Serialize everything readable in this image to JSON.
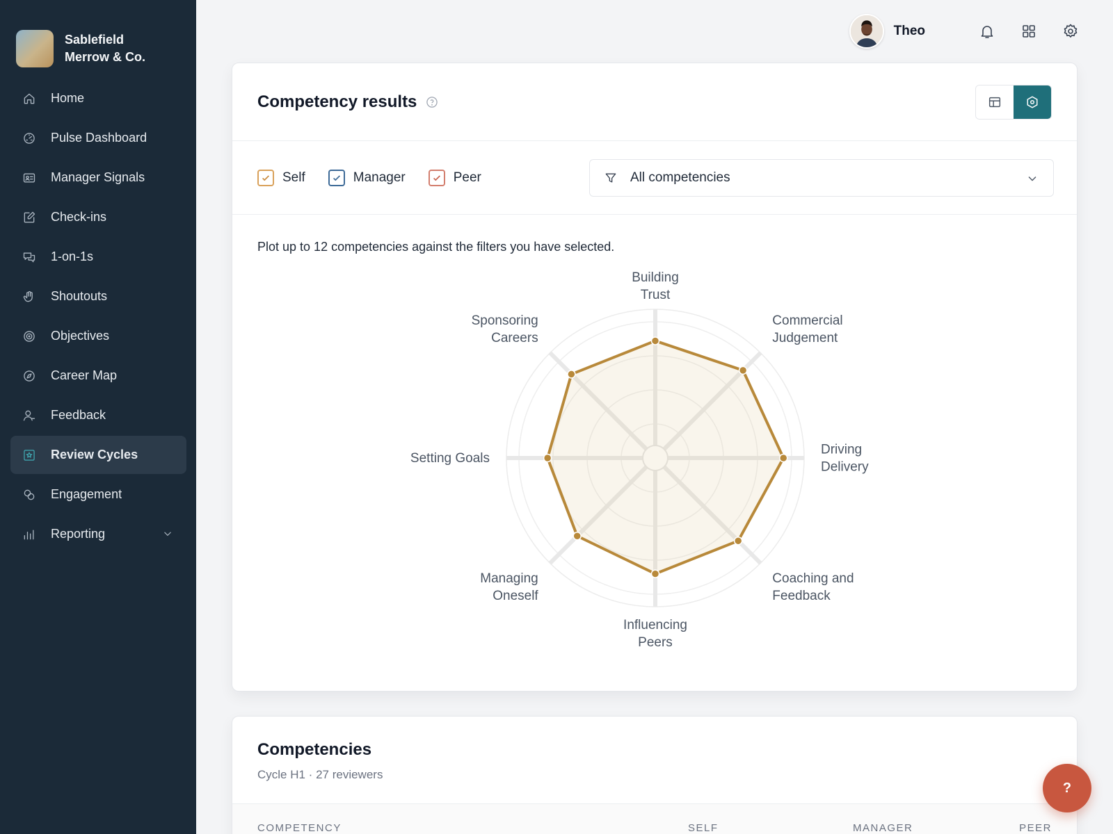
{
  "brand": {
    "name_line1": "Sablefield",
    "name_line2": "Merrow & Co."
  },
  "sidebar": {
    "items": [
      {
        "label": "Home",
        "icon": "home-icon"
      },
      {
        "label": "Pulse Dashboard",
        "icon": "gauge-icon"
      },
      {
        "label": "Manager Signals",
        "icon": "id-card-icon"
      },
      {
        "label": "Check-ins",
        "icon": "edit-icon"
      },
      {
        "label": "1-on-1s",
        "icon": "chat-icon"
      },
      {
        "label": "Shoutouts",
        "icon": "hand-icon"
      },
      {
        "label": "Objectives",
        "icon": "target-icon"
      },
      {
        "label": "Career Map",
        "icon": "compass-icon"
      },
      {
        "label": "Feedback",
        "icon": "user-icon"
      },
      {
        "label": "Review Cycles",
        "icon": "star-box-icon",
        "active": true
      },
      {
        "label": "Engagement",
        "icon": "link-icon"
      },
      {
        "label": "Reporting",
        "icon": "bar-chart-icon",
        "expandable": true
      }
    ]
  },
  "topbar": {
    "user_name": "Theo",
    "icons": [
      "bell-icon",
      "grid-icon",
      "gear-icon"
    ]
  },
  "results": {
    "title": "Competency results",
    "view_modes": [
      "table-view",
      "radar-view"
    ],
    "active_view": "radar-view",
    "filters": [
      {
        "label": "Self",
        "checked": true,
        "color": "#c98a3c"
      },
      {
        "label": "Manager",
        "checked": true,
        "color": "#3d6a97"
      },
      {
        "label": "Peer",
        "checked": true,
        "color": "#c8634f"
      }
    ],
    "dropdown_value": "All competencies",
    "hint": "Plot up to 12 competencies against the filters you have selected."
  },
  "chart_data": {
    "type": "radar",
    "axes": [
      [
        "Building",
        "Trust"
      ],
      [
        "Commercial",
        "Judgement"
      ],
      [
        "Driving",
        "Delivery"
      ],
      [
        "Coaching and",
        "Feedback"
      ],
      [
        "Influencing",
        "Peers"
      ],
      [
        "Managing",
        "Oneself"
      ],
      [
        "Setting Goals"
      ],
      [
        "Sponsoring",
        "Careers"
      ]
    ],
    "series": [
      {
        "values": [
          0.86,
          0.91,
          0.94,
          0.86,
          0.85,
          0.81,
          0.79,
          0.87
        ],
        "color": "#b8893a"
      }
    ],
    "range": [
      0,
      1
    ],
    "rings": 4,
    "grid": true
  },
  "competencies": {
    "title": "Competencies",
    "subtitle": "Cycle H1 · 27 reviewers",
    "columns": [
      "COMPETENCY",
      "SELF",
      "MANAGER",
      "PEER"
    ]
  },
  "help_fab": {
    "label": "?"
  },
  "colors": {
    "sidebar_bg": "#1b2a38",
    "accent": "#1f6f7a",
    "series": "#b8893a",
    "fab": "#c8573f"
  }
}
